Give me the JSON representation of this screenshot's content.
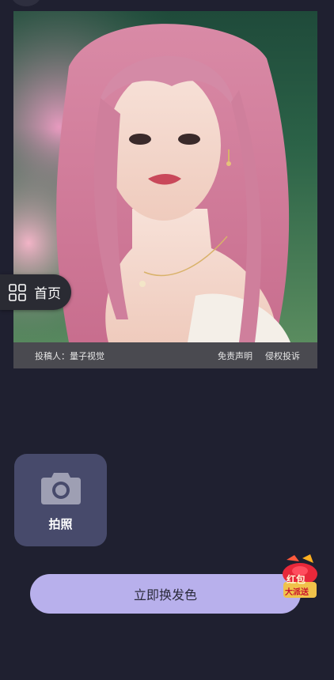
{
  "credit": {
    "uploader": "投稿人：量子视觉",
    "disclaimer": "免责声明",
    "report": "侵权投诉"
  },
  "nav": {
    "home_label": "首页",
    "home_icon": "grid-icon"
  },
  "camera": {
    "label": "拍照",
    "icon": "camera-icon"
  },
  "cta": {
    "label": "立即换发色"
  },
  "promo": {
    "line1": "红包",
    "line2": "大派送"
  },
  "colors": {
    "background": "#1f2030",
    "cta": "#b8b0ec",
    "camera_tile": "#474a6b",
    "credit_bar": "#4a4a50",
    "hair": "#e08aa8"
  }
}
